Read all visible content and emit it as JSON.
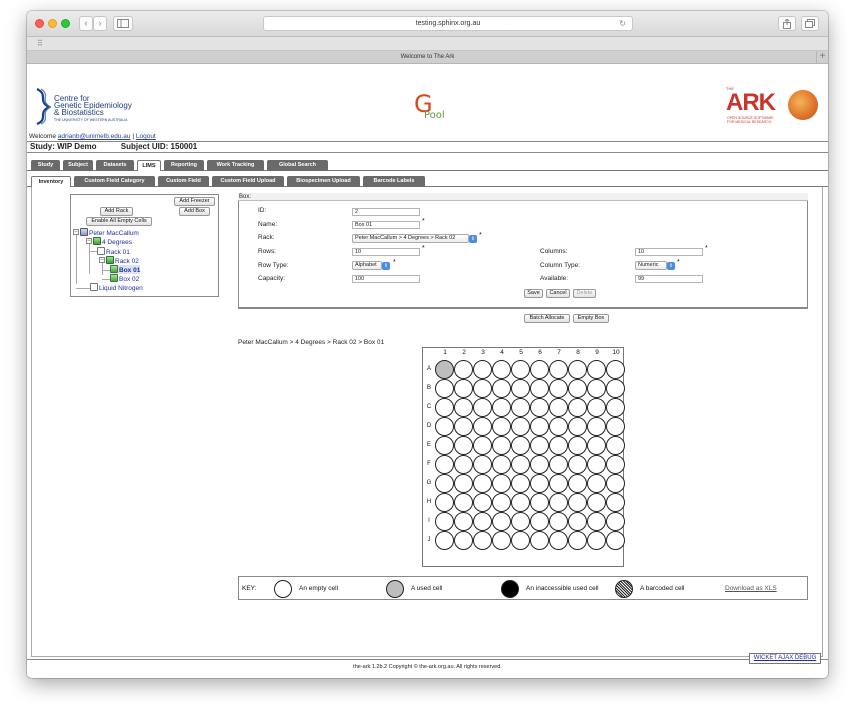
{
  "browser": {
    "url": "testing.sphinx.org.au",
    "tab_title": "Welcome to The Ark",
    "new_tab_label": "+",
    "reload_icon": "↻",
    "back_icon": "‹",
    "forward_icon": "›",
    "bookmarks_icon": "⠿"
  },
  "header": {
    "cge_name_line1": "Centre for",
    "cge_name_line2": "Genetic Epidemiology",
    "cge_name_line3": "& Biostatistics",
    "cge_sub": "THE UNIVERSITY OF WESTERN AUSTRALIA",
    "gpool_g": "G",
    "gpool_text": "Pool",
    "ark_the": "THE",
    "ark_word": "ARK",
    "ark_sub_line1": "OPEN SOURCE SOFTWARE",
    "ark_sub_line2": "FOR MEDICAL RESEARCH"
  },
  "user": {
    "welcome_text": "Welcome",
    "email": "adrianb@unimelb.edu.au",
    "separator": "|",
    "logout_label": "Logout"
  },
  "study": {
    "study_text": "Study: WIP Demo",
    "subject_text": "Subject UID: 150001"
  },
  "main_tabs": [
    "Study",
    "Subject",
    "Datasets",
    "LIMS",
    "Reporting",
    "Work Tracking",
    "Global Search"
  ],
  "main_tabs_active": "LIMS",
  "sub_tabs": [
    "Inventory",
    "Custom Field Category",
    "Custom Field",
    "Custom Field Upload",
    "Biospecimen Upload",
    "Barcode Labels"
  ],
  "sub_tabs_active": "Inventory",
  "tree_panel": {
    "add_freezer": "Add Freezer",
    "add_rack": "Add Rack",
    "add_box": "Add Box",
    "enable_all": "Enable All Empty Cells",
    "nodes": {
      "site": "Peter MacCallum",
      "tank": "4 Degrees",
      "rack1": "Rack 01",
      "rack2": "Rack 02",
      "box1": "Box 01",
      "box2": "Box 02",
      "liquid": "Liquid Nitrogen"
    }
  },
  "box_form": {
    "legend": "Box:",
    "id_label": "ID:",
    "id_value": "2",
    "name_label": "Name:",
    "name_value": "Box 01",
    "rack_label": "Rack:",
    "rack_value": "Peter MacCallum > 4 Degrees > Rack 02",
    "rows_label": "Rows:",
    "rows_value": "10",
    "columns_label": "Columns:",
    "columns_value": "10",
    "row_type_label": "Row Type:",
    "row_type_value": "Alphabet",
    "column_type_label": "Column Type:",
    "column_type_value": "Numeric",
    "capacity_label": "Capacity:",
    "capacity_value": "100",
    "available_label": "Available:",
    "available_value": "99",
    "required_marker": "*",
    "save": "Save",
    "cancel": "Cancel",
    "delete": "Delete",
    "batch_allocate": "Batch Allocate",
    "empty_box": "Empty Box"
  },
  "breadcrumb": "Peter MacCallum > 4 Degrees > Rack 02 > Box 01",
  "grid": {
    "columns": [
      "1",
      "2",
      "3",
      "4",
      "5",
      "6",
      "7",
      "8",
      "9",
      "10"
    ],
    "rows": [
      "A",
      "B",
      "C",
      "D",
      "E",
      "F",
      "G",
      "H",
      "I",
      "J"
    ],
    "used_cells": [
      "A1"
    ]
  },
  "key": {
    "title": "KEY:",
    "empty": "An empty cell",
    "used": "A used cell",
    "inaccessible": "An inaccessible used cell",
    "barcoded": "A barcoded cell",
    "download": "Download as XLS"
  },
  "debug_label": "WICKET AJAX DEBUG",
  "footer": "the-ark 1.2b.2 Copyright © the-ark.org.au. All rights reserved."
}
